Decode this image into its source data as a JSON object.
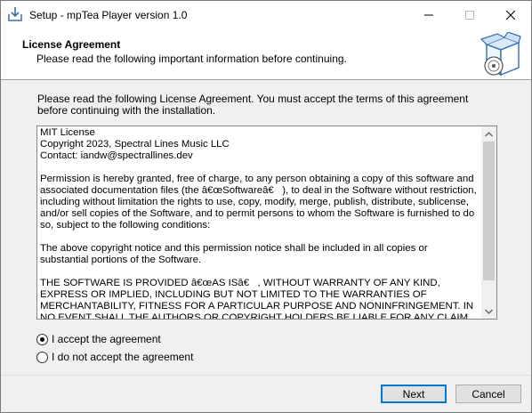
{
  "window": {
    "title": "Setup - mpTea Player version 1.0"
  },
  "header": {
    "title": "License Agreement",
    "subtitle": "Please read the following important information before continuing."
  },
  "intro": "Please read the following License Agreement. You must accept the terms of this agreement before continuing with the installation.",
  "license": {
    "text": "MIT License\nCopyright 2023, Spectral Lines Music LLC\nContact: iandw@spectrallines.dev\n\nPermission is hereby granted, free of charge, to any person obtaining a copy of this software and associated documentation files (the â€œSoftwareâ€   ), to deal in the Software without restriction, including without limitation the rights to use, copy, modify, merge, publish, distribute, sublicense, and/or sell copies of the Software, and to permit persons to whom the Software is furnished to do so, subject to the following conditions:\n\nThe above copyright notice and this permission notice shall be included in all copies or substantial portions of the Software.\n\nTHE SOFTWARE IS PROVIDED â€œAS ISâ€   , WITHOUT WARRANTY OF ANY KIND, EXPRESS OR IMPLIED, INCLUDING BUT NOT LIMITED TO THE WARRANTIES OF MERCHANTABILITY, FITNESS FOR A PARTICULAR PURPOSE AND NONINFRINGEMENT. IN NO EVENT SHALL THE AUTHORS OR COPYRIGHT HOLDERS BE LIABLE FOR ANY CLAIM, DAMAGES OR OTHER LIABILITY, WHETHER IN AN"
  },
  "options": {
    "accept": "I accept the agreement",
    "decline": "I do not accept the agreement",
    "selected": "accept"
  },
  "buttons": {
    "next": "Next",
    "cancel": "Cancel"
  },
  "colors": {
    "focus_border": "#0078d7",
    "body_bg": "#f0f0f0"
  }
}
